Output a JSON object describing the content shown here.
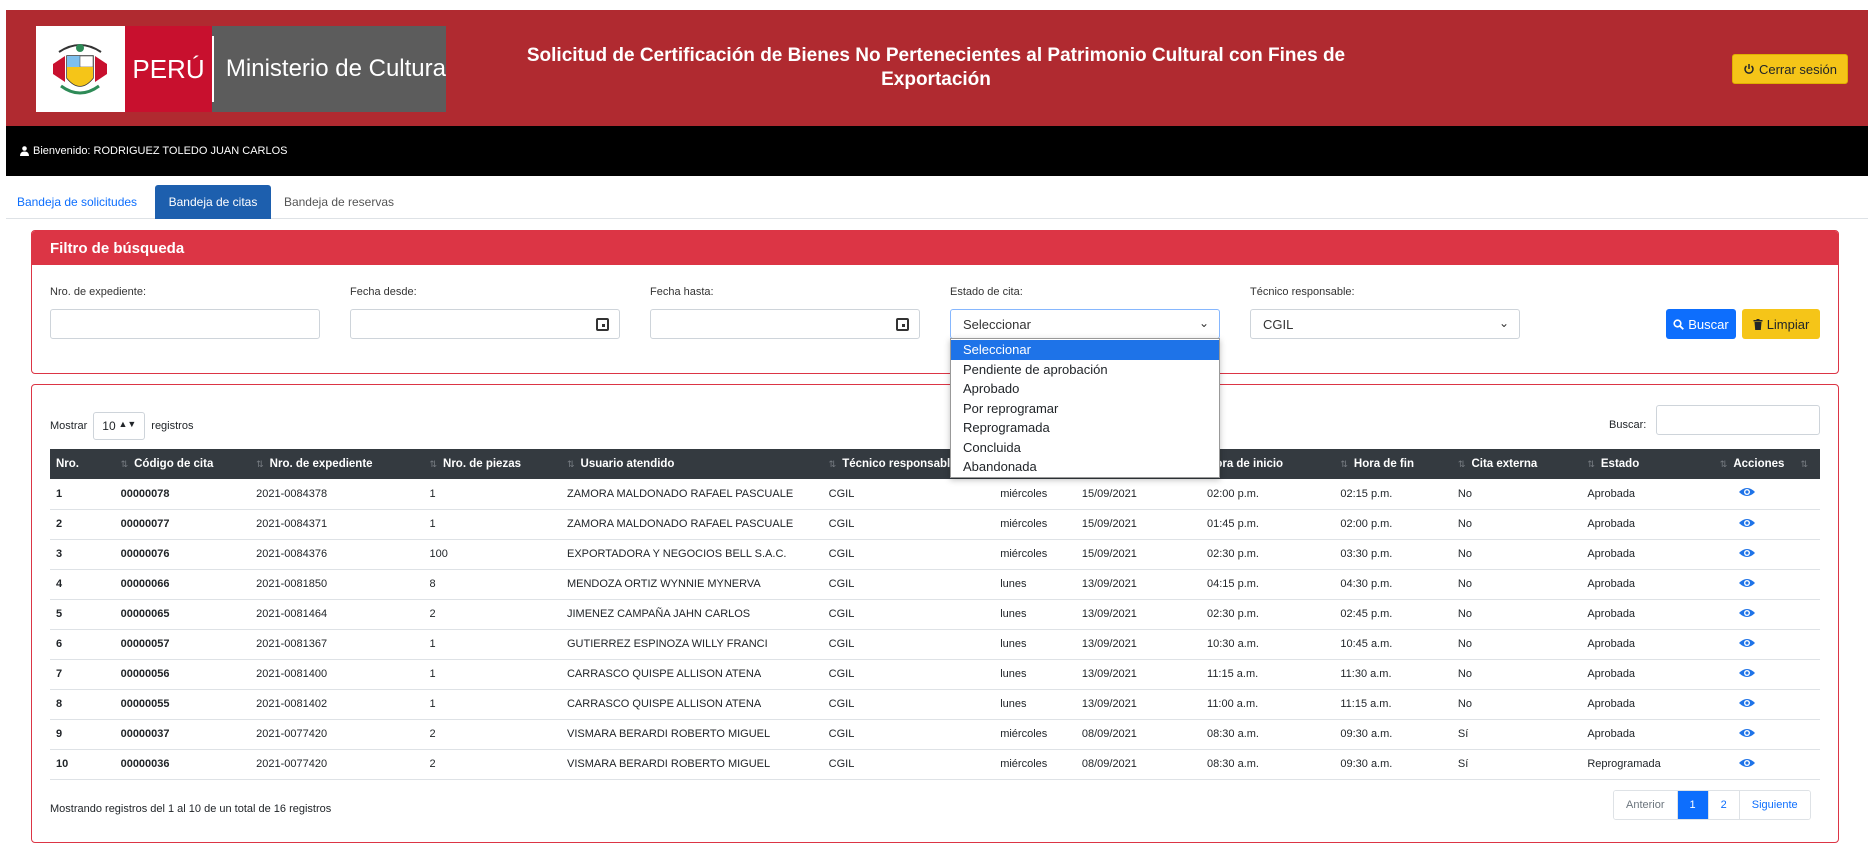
{
  "header": {
    "brand_country": "PERÚ",
    "brand_ministry": "Ministerio de Cultura",
    "title": "Solicitud de Certificación de Bienes No Pertenecientes al Patrimonio Cultural con Fines de Exportación",
    "logout_label": "Cerrar sesión",
    "accent": "#b02a30"
  },
  "welcome": {
    "text": "Bienvenido: RODRIGUEZ TOLEDO JUAN CARLOS"
  },
  "tabs": [
    {
      "label": "Bandeja de solicitudes"
    },
    {
      "label": "Bandeja de citas"
    },
    {
      "label": "Bandeja de reservas"
    }
  ],
  "filter": {
    "title": "Filtro de búsqueda",
    "expediente_label": "Nro. de expediente:",
    "fecha_desde_label": "Fecha desde:",
    "fecha_hasta_label": "Fecha hasta:",
    "estado_label": "Estado de cita:",
    "estado_value": "Seleccionar",
    "tecnico_label": "Técnico responsable:",
    "tecnico_value": "CGIL",
    "buscar_label": "Buscar",
    "limpiar_label": "Limpiar"
  },
  "estado_options": [
    "Seleccionar",
    "Pendiente de aprobación",
    "Aprobado",
    "Por reprogramar",
    "Reprogramada",
    "Concluida",
    "Abandonada"
  ],
  "table": {
    "show_prefix": "Mostrar",
    "show_value": "10",
    "show_suffix": "registros",
    "search_label": "Buscar:",
    "columns": [
      "Nro.",
      "Código de cita",
      "Nro. de expediente",
      "Nro. de piezas",
      "Usuario atendido",
      "Técnico responsable",
      "",
      "Hora de inicio",
      "Hora de fin",
      "Cita externa",
      "Estado",
      "Acciones"
    ],
    "rows": [
      [
        "1",
        "00000078",
        "2021-0084378",
        "1",
        "ZAMORA MALDONADO RAFAEL PASCUALE",
        "CGIL",
        "miércoles",
        "15/09/2021",
        "02:00 p.m.",
        "02:15 p.m.",
        "No",
        "Aprobada"
      ],
      [
        "2",
        "00000077",
        "2021-0084371",
        "1",
        "ZAMORA MALDONADO RAFAEL PASCUALE",
        "CGIL",
        "miércoles",
        "15/09/2021",
        "01:45 p.m.",
        "02:00 p.m.",
        "No",
        "Aprobada"
      ],
      [
        "3",
        "00000076",
        "2021-0084376",
        "100",
        "EXPORTADORA Y NEGOCIOS BELL S.A.C.",
        "CGIL",
        "miércoles",
        "15/09/2021",
        "02:30 p.m.",
        "03:30 p.m.",
        "No",
        "Aprobada"
      ],
      [
        "4",
        "00000066",
        "2021-0081850",
        "8",
        "MENDOZA ORTIZ WYNNIE MYNERVA",
        "CGIL",
        "lunes",
        "13/09/2021",
        "04:15 p.m.",
        "04:30 p.m.",
        "No",
        "Aprobada"
      ],
      [
        "5",
        "00000065",
        "2021-0081464",
        "2",
        "JIMENEZ CAMPAÑA JAHN CARLOS",
        "CGIL",
        "lunes",
        "13/09/2021",
        "02:30 p.m.",
        "02:45 p.m.",
        "No",
        "Aprobada"
      ],
      [
        "6",
        "00000057",
        "2021-0081367",
        "1",
        "GUTIERREZ ESPINOZA WILLY FRANCI",
        "CGIL",
        "lunes",
        "13/09/2021",
        "10:30 a.m.",
        "10:45 a.m.",
        "No",
        "Aprobada"
      ],
      [
        "7",
        "00000056",
        "2021-0081400",
        "1",
        "CARRASCO QUISPE ALLISON ATENA",
        "CGIL",
        "lunes",
        "13/09/2021",
        "11:15 a.m.",
        "11:30 a.m.",
        "No",
        "Aprobada"
      ],
      [
        "8",
        "00000055",
        "2021-0081402",
        "1",
        "CARRASCO QUISPE ALLISON ATENA",
        "CGIL",
        "lunes",
        "13/09/2021",
        "11:00 a.m.",
        "11:15 a.m.",
        "No",
        "Aprobada"
      ],
      [
        "9",
        "00000037",
        "2021-0077420",
        "2",
        "VISMARA BERARDI ROBERTO MIGUEL",
        "CGIL",
        "miércoles",
        "08/09/2021",
        "08:30 a.m.",
        "09:30 a.m.",
        "Sí",
        "Aprobada"
      ],
      [
        "10",
        "00000036",
        "2021-0077420",
        "2",
        "VISMARA BERARDI ROBERTO MIGUEL",
        "CGIL",
        "miércoles",
        "08/09/2021",
        "08:30 a.m.",
        "09:30 a.m.",
        "Sí",
        "Reprogramada"
      ]
    ],
    "info": "Mostrando registros del 1 al 10 de un total de 16 registros",
    "pager": {
      "prev": "Anterior",
      "page1": "1",
      "page2": "2",
      "next": "Siguiente"
    }
  }
}
